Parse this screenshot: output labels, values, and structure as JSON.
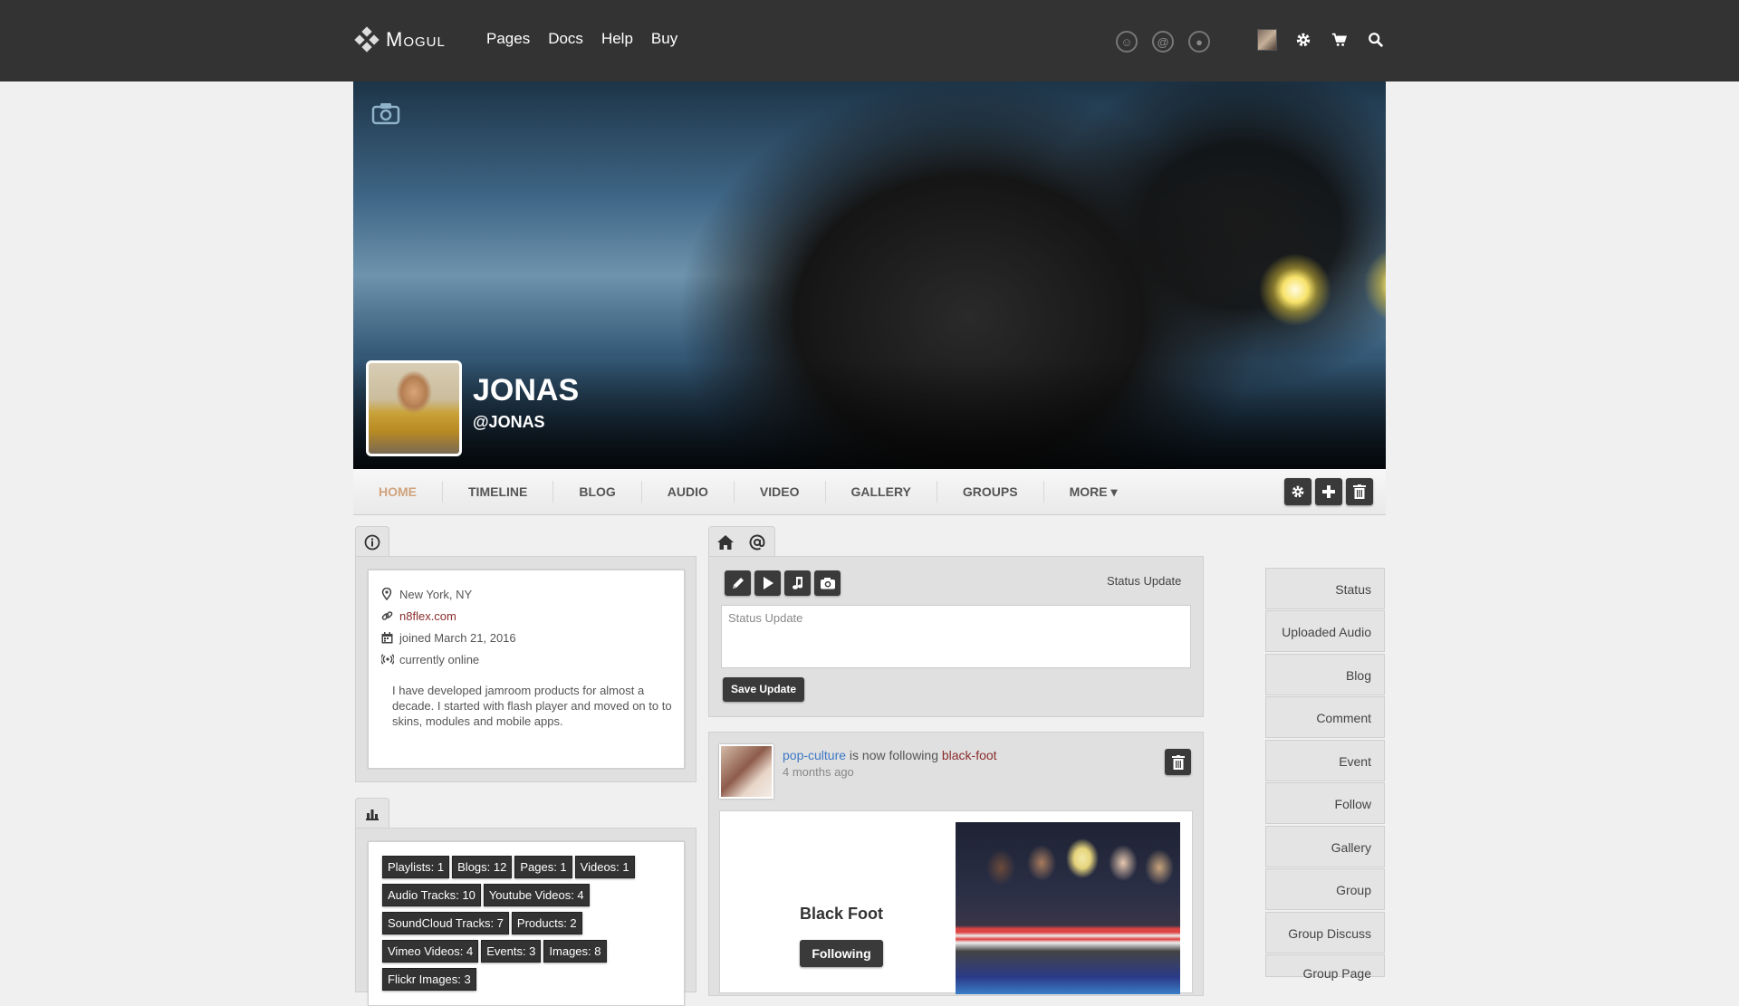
{
  "brand": {
    "name": "Mogul"
  },
  "topnav": {
    "items": [
      "Pages",
      "Docs",
      "Help",
      "Buy"
    ]
  },
  "profile": {
    "name": "JONAS",
    "handle": "@JONAS"
  },
  "tabs": {
    "items": [
      "HOME",
      "TIMELINE",
      "BLOG",
      "AUDIO",
      "VIDEO",
      "GALLERY",
      "GROUPS",
      "MORE ▾"
    ],
    "active": "HOME"
  },
  "info": {
    "location": "New York, NY",
    "website": "n8flex.com",
    "joined": "joined March 21, 2016",
    "online": "currently online",
    "bio": "I have developed jamroom products for almost a decade. I started with flash player and moved on to to skins, modules and mobile apps."
  },
  "stats": {
    "items": [
      "Playlists: 1",
      "Blogs: 12",
      "Pages: 1",
      "Videos: 1",
      "Audio Tracks: 10",
      "Youtube Videos: 4",
      "SoundCloud Tracks: 7",
      "Products: 2",
      "Vimeo Videos: 4",
      "Events: 3",
      "Images: 8",
      "Flickr Images: 3"
    ]
  },
  "composer": {
    "label": "Status Update",
    "placeholder": "Status Update",
    "save_label": "Save Update"
  },
  "feed": {
    "user": "pop-culture",
    "action": " is now following ",
    "target": "black-foot",
    "time": "4 months ago",
    "card_title": "Black Foot",
    "card_button": "Following"
  },
  "sidebar": {
    "items": [
      "Status",
      "Uploaded Audio",
      "Blog",
      "Comment",
      "Event",
      "Follow",
      "Gallery",
      "Group",
      "Group Discuss",
      "Group Page"
    ]
  },
  "colors": {
    "topbar": "#333333",
    "active_tab": "#d0a37d",
    "link_user": "#3b78c4",
    "link_target": "#8a2c2c"
  }
}
